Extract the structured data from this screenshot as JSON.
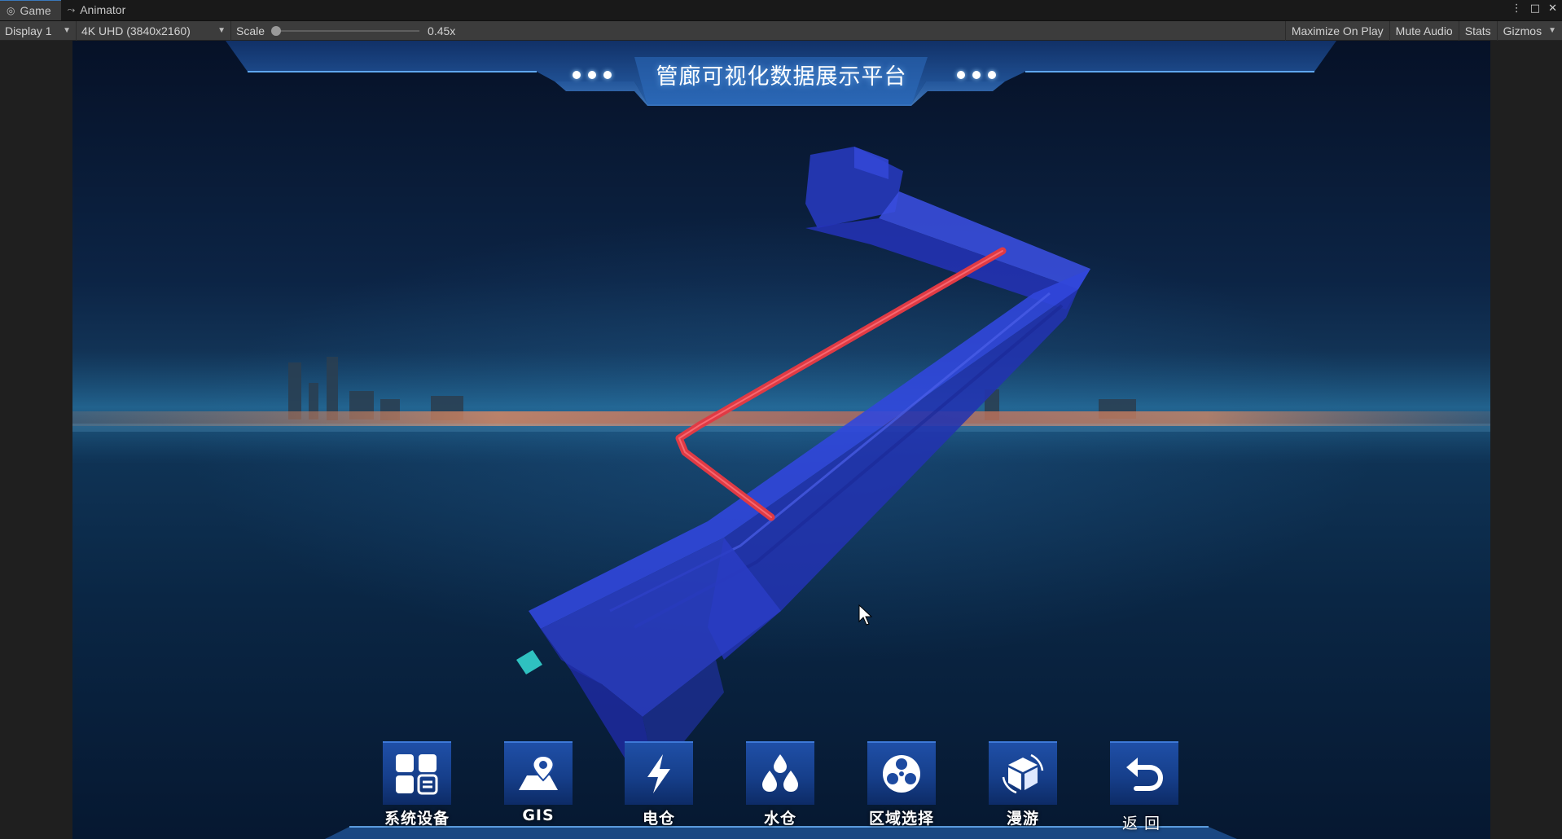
{
  "tabs": [
    {
      "label": "Game",
      "icon": "gamepad-icon",
      "active": true
    },
    {
      "label": "Animator",
      "icon": "animator-icon",
      "active": false
    }
  ],
  "toolbar": {
    "display": "Display 1",
    "resolution": "4K UHD (3840x2160)",
    "scale_label": "Scale",
    "scale_value": "0.45x",
    "maximize": "Maximize On Play",
    "mute": "Mute Audio",
    "stats": "Stats",
    "gizmos": "Gizmos"
  },
  "header": {
    "title": "管廊可视化数据展示平台"
  },
  "tools": [
    {
      "label": "系统设备",
      "icon": "grid-devices-icon"
    },
    {
      "label": "GIS",
      "icon": "map-pin-icon"
    },
    {
      "label": "电仓",
      "icon": "lightning-icon"
    },
    {
      "label": "水仓",
      "icon": "water-drops-icon"
    },
    {
      "label": "区域选择",
      "icon": "area-select-icon"
    },
    {
      "label": "漫游",
      "icon": "roam-cube-icon"
    },
    {
      "label": "返回",
      "icon": "return-arrow-icon"
    }
  ],
  "colors": {
    "corridor": "#2436d6",
    "pipe": "#e03a44",
    "header_panel": "#2a63b5",
    "button": "#1c4aa0"
  }
}
